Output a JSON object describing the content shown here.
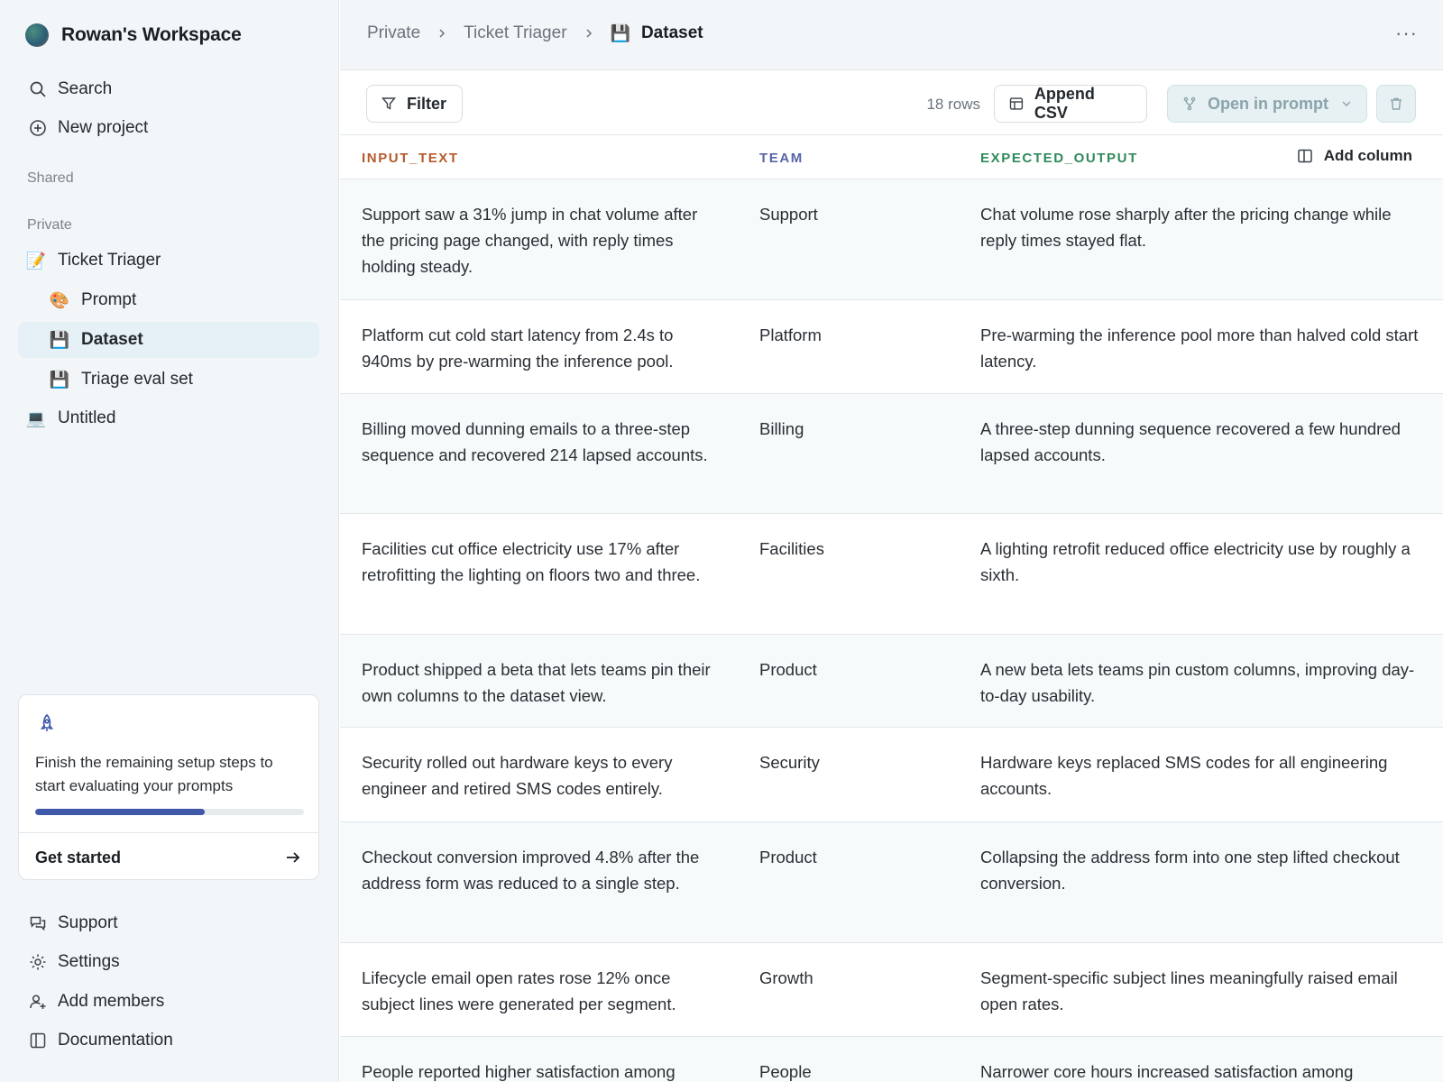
{
  "workspace": {
    "name": "Rowan's Workspace"
  },
  "sidebar": {
    "search_label": "Search",
    "new_project_label": "New project",
    "shared_label": "Shared",
    "private_label": "Private",
    "tree": [
      {
        "label": "Ticket Triager",
        "emoji": "📝"
      },
      {
        "label": "Prompt",
        "emoji": "🎨"
      },
      {
        "label": "Dataset",
        "emoji": "💾"
      },
      {
        "label": "Triage eval set",
        "emoji": "💾"
      },
      {
        "label": "Untitled",
        "emoji": "💻"
      }
    ],
    "setup": {
      "text": "Finish the remaining setup steps to start evaluating your prompts",
      "progress": 0.63,
      "cta": "Get started"
    },
    "bottom": {
      "support": "Support",
      "settings": "Settings",
      "add_members": "Add members",
      "documentation": "Documentation"
    }
  },
  "breadcrumb": {
    "items": [
      "Private",
      "Ticket Triager"
    ],
    "current": "Dataset",
    "current_emoji": "💾"
  },
  "toolbar": {
    "filter_label": "Filter",
    "rows_count": "18 rows",
    "append_label": "Append CSV",
    "open_label": "Open in prompt"
  },
  "table": {
    "headers": {
      "input": "INPUT_TEXT",
      "team": "TEAM",
      "expected": "EXPECTED_OUTPUT"
    },
    "add_column_label": "Add column",
    "rows": [
      {
        "input": "Support saw a 31% jump in chat volume after the pricing page changed, with reply times holding steady.",
        "team": "Support",
        "expected": "Chat volume rose sharply after the pricing change while reply times stayed flat."
      },
      {
        "input": "Platform cut cold start latency from 2.4s to 940ms by pre-warming the inference pool.",
        "team": "Platform",
        "expected": "Pre-warming the inference pool more than halved cold start latency."
      },
      {
        "input": "Billing moved dunning emails to a three-step sequence and recovered 214 lapsed accounts.",
        "team": "Billing",
        "expected": "A three-step dunning sequence recovered a few hundred lapsed accounts."
      },
      {
        "input": "Facilities cut office electricity use 17% after retrofitting the lighting on floors two and three.",
        "team": "Facilities",
        "expected": "A lighting retrofit reduced office electricity use by roughly a sixth."
      },
      {
        "input": "Product shipped a beta that lets teams pin their own columns to the dataset view.",
        "team": "Product",
        "expected": "A new beta lets teams pin custom columns, improving day-to-day usability."
      },
      {
        "input": "Security rolled out hardware keys to every engineer and retired SMS codes entirely.",
        "team": "Security",
        "expected": "Hardware keys replaced SMS codes for all engineering accounts."
      },
      {
        "input": "Checkout conversion improved 4.8% after the address form was reduced to a single step.",
        "team": "Product",
        "expected": "Collapsing the address form into one step lifted checkout conversion."
      },
      {
        "input": "Lifecycle email open rates rose 12% once subject lines were generated per segment.",
        "team": "Growth",
        "expected": "Segment-specific subject lines meaningfully raised email open rates."
      },
      {
        "input": "People reported higher satisfaction among",
        "team": "People",
        "expected": "Narrower core hours increased satisfaction among"
      }
    ]
  }
}
